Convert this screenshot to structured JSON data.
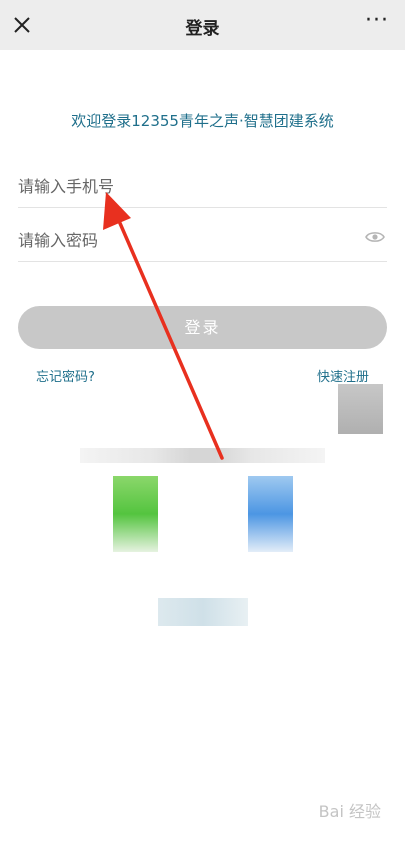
{
  "header": {
    "title": "登录",
    "more": "···"
  },
  "welcome": "欢迎登录12355青年之声·智慧团建系统",
  "form": {
    "phone_placeholder": "请输入手机号",
    "password_placeholder": "请输入密码",
    "login_label": "登录"
  },
  "links": {
    "forgot": "忘记密码?",
    "register": "快速注册"
  },
  "watermark": "Bai 经验",
  "colors": {
    "accent": "#1f6f8b",
    "button_disabled": "#c8c8c8",
    "annotation": "#e8301f"
  }
}
